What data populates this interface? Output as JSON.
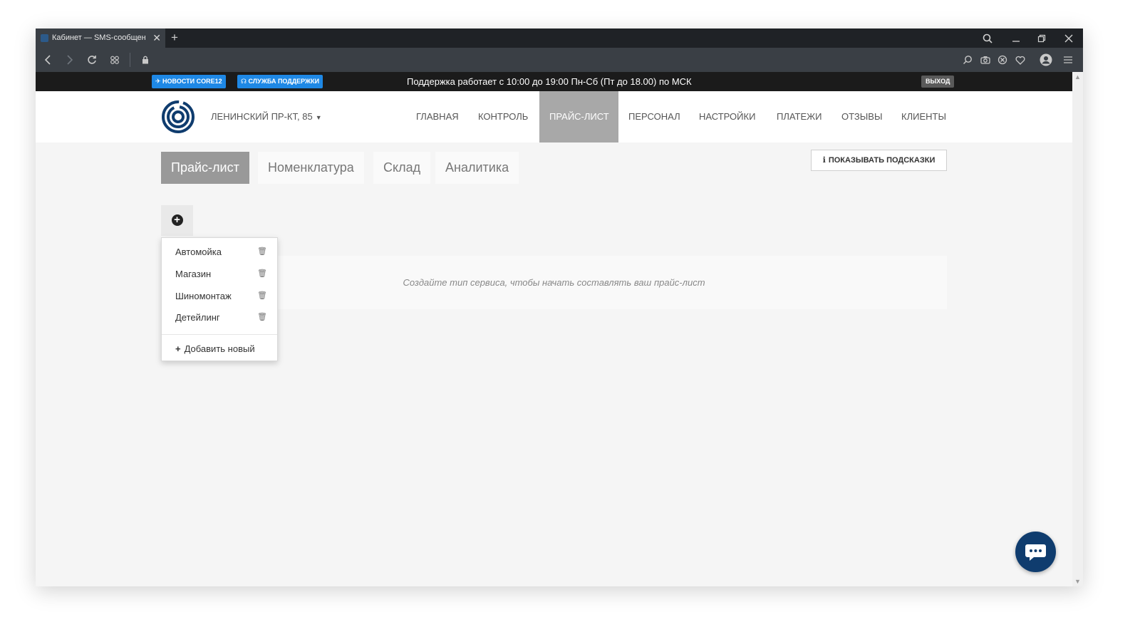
{
  "browser": {
    "tab_title": "Кабинет — SMS-сообщен",
    "tab_close": "✕",
    "new_tab": "+",
    "window_controls": [
      "search-icon",
      "minimize-icon",
      "restore-icon",
      "close-icon"
    ],
    "nav_icons": [
      "back-icon",
      "forward-icon",
      "reload-icon",
      "speed-dial-icon",
      "lock-icon"
    ],
    "toolbar_icons": [
      "search-icon",
      "camera-icon",
      "adblock-icon",
      "heart-icon",
      "profile-icon",
      "menu-icon"
    ]
  },
  "infobar": {
    "news_label": "НОВОСТИ CORE12",
    "support_label": "СЛУЖБА ПОДДЕРЖКИ",
    "support_hours": "Поддержка работает с 10:00 до 19:00 Пн-Сб (Пт до 18.00) по МСК",
    "logout_label": "ВЫХОД",
    "accent_color": "#1e88e5"
  },
  "header": {
    "branch": "ЛЕНИНСКИЙ ПР-КТ, 85",
    "menu": [
      {
        "label": "ГЛАВНАЯ",
        "active": false
      },
      {
        "label": "КОНТРОЛЬ",
        "active": false
      },
      {
        "label": "ПРАЙС-ЛИСТ",
        "active": true
      },
      {
        "label": "ПЕРСОНАЛ",
        "active": false
      },
      {
        "label": "НАСТРОЙКИ",
        "active": false
      },
      {
        "label": "ПЛАТЕЖИ",
        "active": false
      },
      {
        "label": "ОТЗЫВЫ",
        "active": false
      },
      {
        "label": "КЛИЕНТЫ",
        "active": false
      }
    ]
  },
  "subtabs": [
    {
      "label": "Прайс-лист",
      "active": true
    },
    {
      "label": "Номенклатура",
      "active": false
    },
    {
      "label": "Склад",
      "active": false
    },
    {
      "label": "Аналитика",
      "active": false
    }
  ],
  "hints_button": "ПОКАЗЫВАТЬ ПОДСКАЗКИ",
  "empty_message": "Создайте тип сервиса, чтобы начать составлять ваш прайс-лист",
  "service_types": [
    "Автомойка",
    "Магазин",
    "Шиномонтаж",
    "Детейлинг"
  ],
  "add_new_label": "Добавить новый",
  "brand_color": "#0f3c6e"
}
